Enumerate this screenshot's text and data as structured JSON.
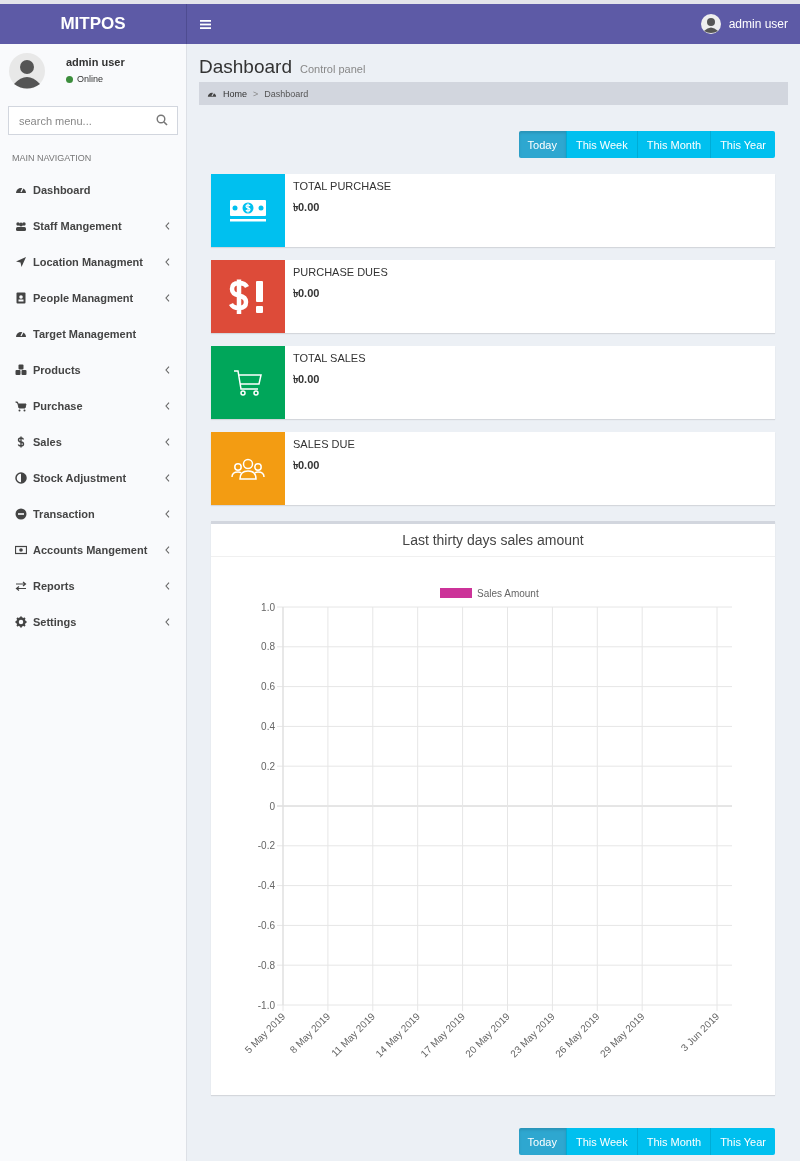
{
  "header": {
    "logo": "MITPOS",
    "user": "admin user"
  },
  "sidebar": {
    "user": {
      "name": "admin user",
      "status": "Online"
    },
    "search": {
      "placeholder": "search menu..."
    },
    "section": "MAIN NAVIGATION",
    "items": [
      {
        "label": "Dashboard",
        "expandable": false
      },
      {
        "label": "Staff Mangement",
        "expandable": true
      },
      {
        "label": "Location Managment",
        "expandable": true
      },
      {
        "label": "People Managment",
        "expandable": true
      },
      {
        "label": "Target Management",
        "expandable": false
      },
      {
        "label": "Products",
        "expandable": true
      },
      {
        "label": "Purchase",
        "expandable": true
      },
      {
        "label": "Sales",
        "expandable": true
      },
      {
        "label": "Stock Adjustment",
        "expandable": true
      },
      {
        "label": "Transaction",
        "expandable": true
      },
      {
        "label": "Accounts Mangement",
        "expandable": true
      },
      {
        "label": "Reports",
        "expandable": true
      },
      {
        "label": "Settings",
        "expandable": true
      }
    ]
  },
  "page": {
    "title": "Dashboard",
    "subtitle": "Control panel",
    "breadcrumb": [
      "Home",
      "Dashboard"
    ],
    "breadcrumb_separator": ">"
  },
  "period_tabs": [
    {
      "label": "Today",
      "selected": true
    },
    {
      "label": "This Week",
      "selected": false
    },
    {
      "label": "This Month",
      "selected": false
    },
    {
      "label": "This Year",
      "selected": false
    }
  ],
  "stats": [
    {
      "label": "TOTAL PURCHASE",
      "value": "৳0.00",
      "color": "#00c0ef"
    },
    {
      "label": "PURCHASE DUES",
      "value": "৳0.00",
      "color": "#dd4b39"
    },
    {
      "label": "TOTAL SALES",
      "value": "৳0.00",
      "color": "#00a65a"
    },
    {
      "label": "SALES DUE",
      "value": "৳0.00",
      "color": "#f39c12"
    }
  ],
  "chart": {
    "title": "Last thirty days sales amount",
    "chart_data": {
      "type": "line",
      "categories": [
        "5 May 2019",
        null,
        null,
        "8 May 2019",
        null,
        null,
        "11 May 2019",
        null,
        null,
        "14 May 2019",
        null,
        null,
        "17 May 2019",
        null,
        null,
        "20 May 2019",
        null,
        null,
        "23 May 2019",
        null,
        null,
        "26 May 2019",
        null,
        null,
        "29 May 2019",
        null,
        null,
        null,
        null,
        "3 Jun 2019"
      ],
      "series": [
        {
          "name": "Sales Amount",
          "color": "#cc3399",
          "values": [
            null,
            null,
            null,
            null,
            null,
            null,
            null,
            null,
            null,
            null,
            null,
            null,
            null,
            null,
            null,
            null,
            null,
            null,
            null,
            null,
            null,
            null,
            null,
            null,
            null,
            null,
            null,
            null,
            null,
            null
          ]
        }
      ],
      "ylim": [
        -1,
        1
      ],
      "grid": true,
      "yticks": [
        {
          "value": 1,
          "label": "1.0"
        },
        {
          "value": 0.8,
          "label": "0.8"
        },
        {
          "value": 0.6,
          "label": "0.6"
        },
        {
          "value": 0.4,
          "label": "0.4"
        },
        {
          "value": 0.2,
          "label": "0.2"
        },
        {
          "value": 0,
          "label": "0"
        },
        {
          "value": -0.2,
          "label": "-0.2"
        },
        {
          "value": -0.4,
          "label": "-0.4"
        },
        {
          "value": -0.6,
          "label": "-0.6"
        },
        {
          "value": -0.8,
          "label": "-0.8"
        },
        {
          "value": -1,
          "label": "-1.0"
        }
      ]
    }
  },
  "period_tabs_bottom": [
    {
      "label": "Today",
      "selected": true
    },
    {
      "label": "This Week",
      "selected": false
    },
    {
      "label": "This Month",
      "selected": false
    },
    {
      "label": "This Year",
      "selected": false
    }
  ]
}
